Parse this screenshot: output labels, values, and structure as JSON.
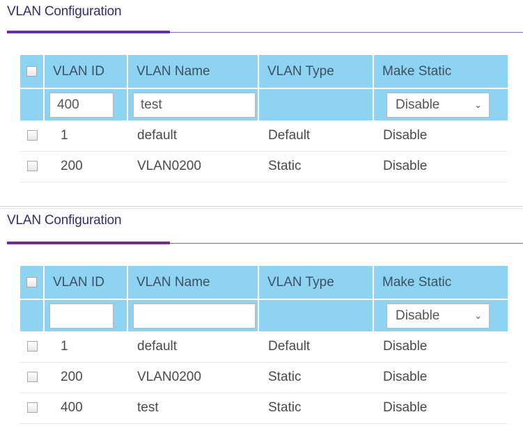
{
  "panels": [
    {
      "title": "VLAN Configuration",
      "columns": [
        "VLAN ID",
        "VLAN Name",
        "VLAN Type",
        "Make Static"
      ],
      "input_row": {
        "vlan_id_value": "400",
        "vlan_name_value": "test",
        "make_static_selected": "Disable"
      },
      "rows": [
        {
          "id": "1",
          "name": "default",
          "type": "Default",
          "static": "Disable"
        },
        {
          "id": "200",
          "name": "VLAN0200",
          "type": "Static",
          "static": "Disable"
        }
      ]
    },
    {
      "title": "VLAN Configuration",
      "columns": [
        "VLAN ID",
        "VLAN Name",
        "VLAN Type",
        "Make Static"
      ],
      "input_row": {
        "vlan_id_value": "",
        "vlan_name_value": "",
        "make_static_selected": "Disable"
      },
      "rows": [
        {
          "id": "1",
          "name": "default",
          "type": "Default",
          "static": "Disable"
        },
        {
          "id": "200",
          "name": "VLAN0200",
          "type": "Static",
          "static": "Disable"
        },
        {
          "id": "400",
          "name": "test",
          "type": "Static",
          "static": "Disable"
        }
      ]
    }
  ],
  "icons": {
    "dropdown": "chevron-down-icon",
    "checkbox": "checkbox-unchecked"
  },
  "colors": {
    "header_bg": "#8ed4f2",
    "title_text": "#3a2a6a",
    "title_underline": "#6b2f9e",
    "rule": "#8a64b4"
  }
}
